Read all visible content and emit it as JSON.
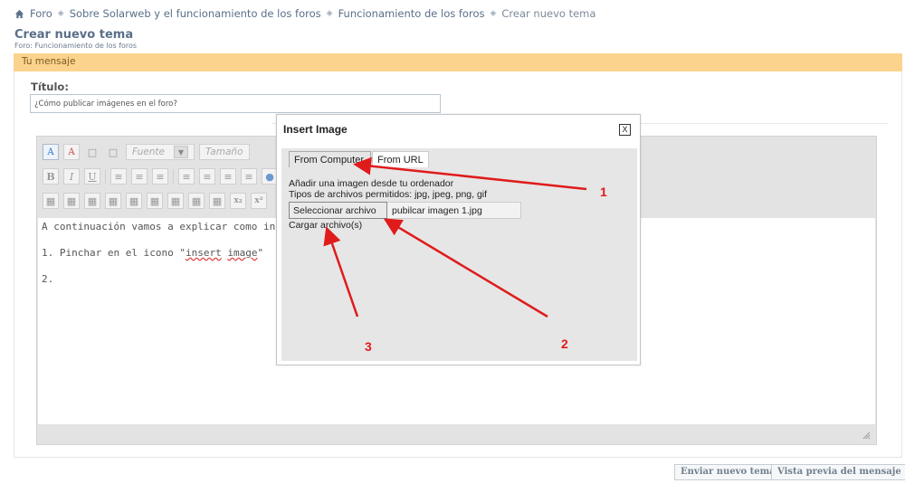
{
  "breadcrumb": {
    "items": [
      "Foro",
      "Sobre Solarweb y el funcionamiento de los foros",
      "Funcionamiento de los foros",
      "Crear nuevo tema"
    ]
  },
  "page": {
    "title": "Crear nuevo tema",
    "subtitle": "Foro: Funcionamiento de los foros",
    "message_bar": "Tu mensaje"
  },
  "form": {
    "title_label": "Título:",
    "title_value": "¿Cómo publicar imágenes en el foro?"
  },
  "toolbar": {
    "font_select": "Fuente",
    "size_select": "Tamaño"
  },
  "editor": {
    "line1": "A continuación vamos a explicar como inclu",
    "line2_prefix": "1. Pinchar en el icono \"",
    "line2_word1": "insert",
    "line2_word2": "image",
    "line2_suffix": "\"",
    "line3": "2."
  },
  "dialog": {
    "title": "Insert Image",
    "close_label": "X",
    "tabs": [
      "From Computer",
      "From URL"
    ],
    "help_line1": "Añadir una imagen desde tu ordenador",
    "help_line2": "Tipos de archivos permitidos: jpg, jpeg, png, gif",
    "choose_file_label": "Seleccionar archivo",
    "file_name": "pubilcar imagen 1.jpg",
    "upload_label": "Cargar archivo(s)"
  },
  "annotations": [
    "1",
    "2",
    "3"
  ],
  "actions": {
    "submit_label": "Enviar nuevo tema",
    "preview_label": "Vista previa del mensaje"
  },
  "colors": {
    "message_bar": "#fcd38c",
    "annotation_red": "#e01b1b",
    "editor_bg": "#e3e3e3"
  }
}
